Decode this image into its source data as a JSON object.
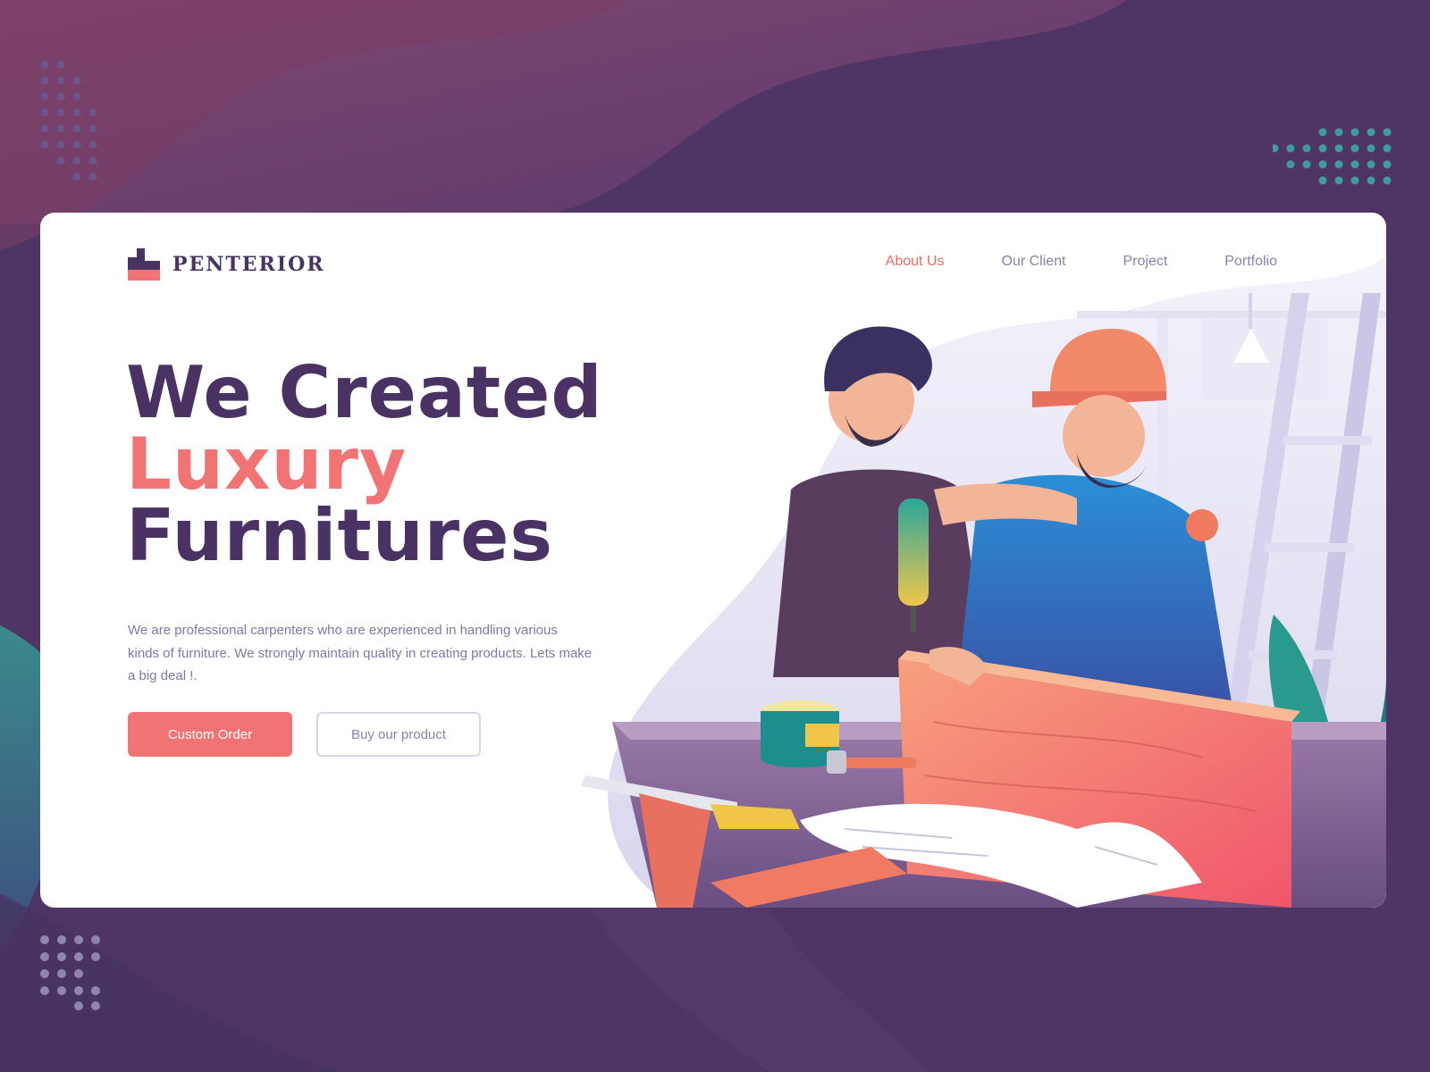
{
  "brand": {
    "name": "PENTERIOR",
    "logo_icon": "stacked-blocks-logo"
  },
  "nav": {
    "items": [
      {
        "label": "About Us",
        "active": true
      },
      {
        "label": "Our Client",
        "active": false
      },
      {
        "label": "Project",
        "active": false
      },
      {
        "label": "Portfolio",
        "active": false
      }
    ]
  },
  "hero": {
    "line1": "We Created",
    "line2": "Luxury",
    "line3": "Furnitures",
    "description": "We are professional carpenters who are experienced in handling various kinds of furniture. We strongly maintain quality in creating products. Lets make a big deal !."
  },
  "buttons": {
    "primary_label": "Custom Order",
    "secondary_label": "Buy our product"
  },
  "colors": {
    "accent": "#f27373",
    "brand_dark": "#4a3364",
    "muted_text": "#7f78a8",
    "background": "#4e3566"
  }
}
